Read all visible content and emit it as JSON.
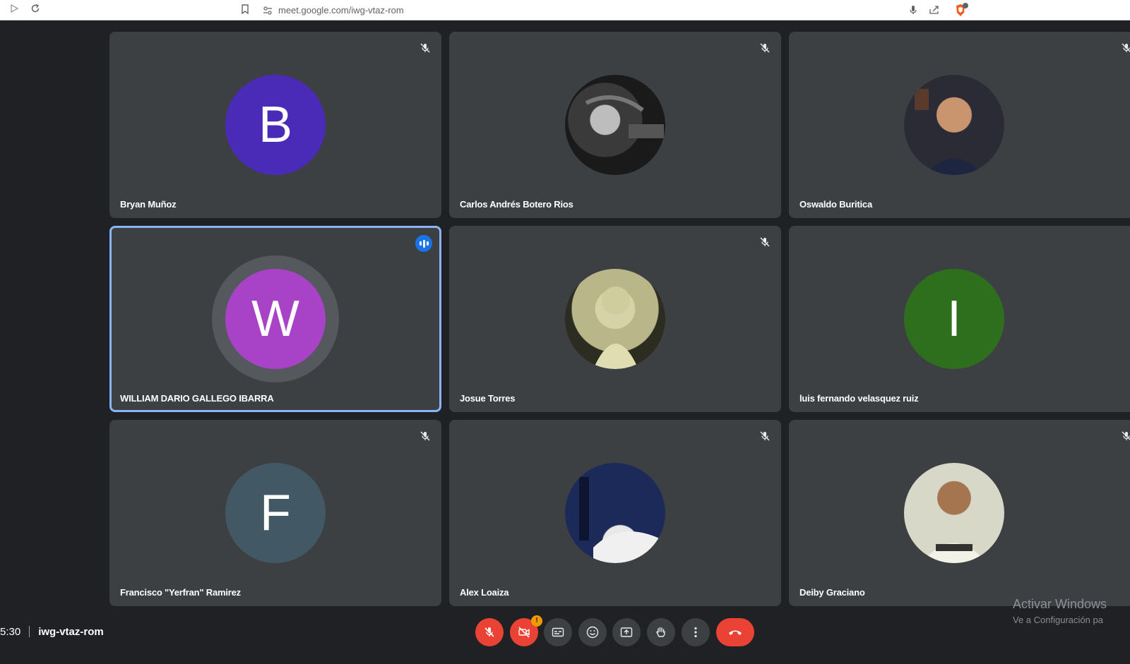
{
  "browser": {
    "url": "meet.google.com/iwg-vtaz-rom"
  },
  "meeting": {
    "time": "5:30",
    "code": "iwg-vtaz-rom"
  },
  "participants": [
    {
      "name": "Bryan Muñoz",
      "initial": "B",
      "avatar_color": "#4a2bb8",
      "muted": true,
      "photo": false
    },
    {
      "name": "Carlos Andrés Botero Rios",
      "initial": "",
      "avatar_color": "#1a1a1a",
      "muted": true,
      "photo": true
    },
    {
      "name": "Oswaldo Buritica",
      "initial": "",
      "avatar_color": "#2b2b35",
      "muted": true,
      "photo": true
    },
    {
      "name": "WILLIAM DARIO GALLEGO IBARRA",
      "initial": "W",
      "avatar_color": "#a843c8",
      "muted": false,
      "speaking": true,
      "photo": false
    },
    {
      "name": "Josue Torres",
      "initial": "",
      "avatar_color": "#c9c79a",
      "muted": true,
      "photo": true
    },
    {
      "name": "luis fernando velasquez ruiz",
      "initial": "I",
      "avatar_color": "#2e6f1e",
      "muted": false,
      "photo": false
    },
    {
      "name": "Francisco \"Yerfran\" Ramirez",
      "initial": "F",
      "avatar_color": "#425865",
      "muted": true,
      "photo": false
    },
    {
      "name": "Alex Loaiza",
      "initial": "",
      "avatar_color": "#1c2a5a",
      "muted": true,
      "photo": true
    },
    {
      "name": "Deiby Graciano",
      "initial": "",
      "avatar_color": "#d8d8c8",
      "muted": true,
      "photo": true
    }
  ],
  "controls": {
    "camera_badge": "!"
  },
  "watermark": {
    "line1": "Activar Windows",
    "line2": "Ve a Configuración pa"
  },
  "colors": {
    "background": "#202124",
    "tile": "#3c4043",
    "accent": "#8ab4f8",
    "danger": "#ea4335"
  }
}
